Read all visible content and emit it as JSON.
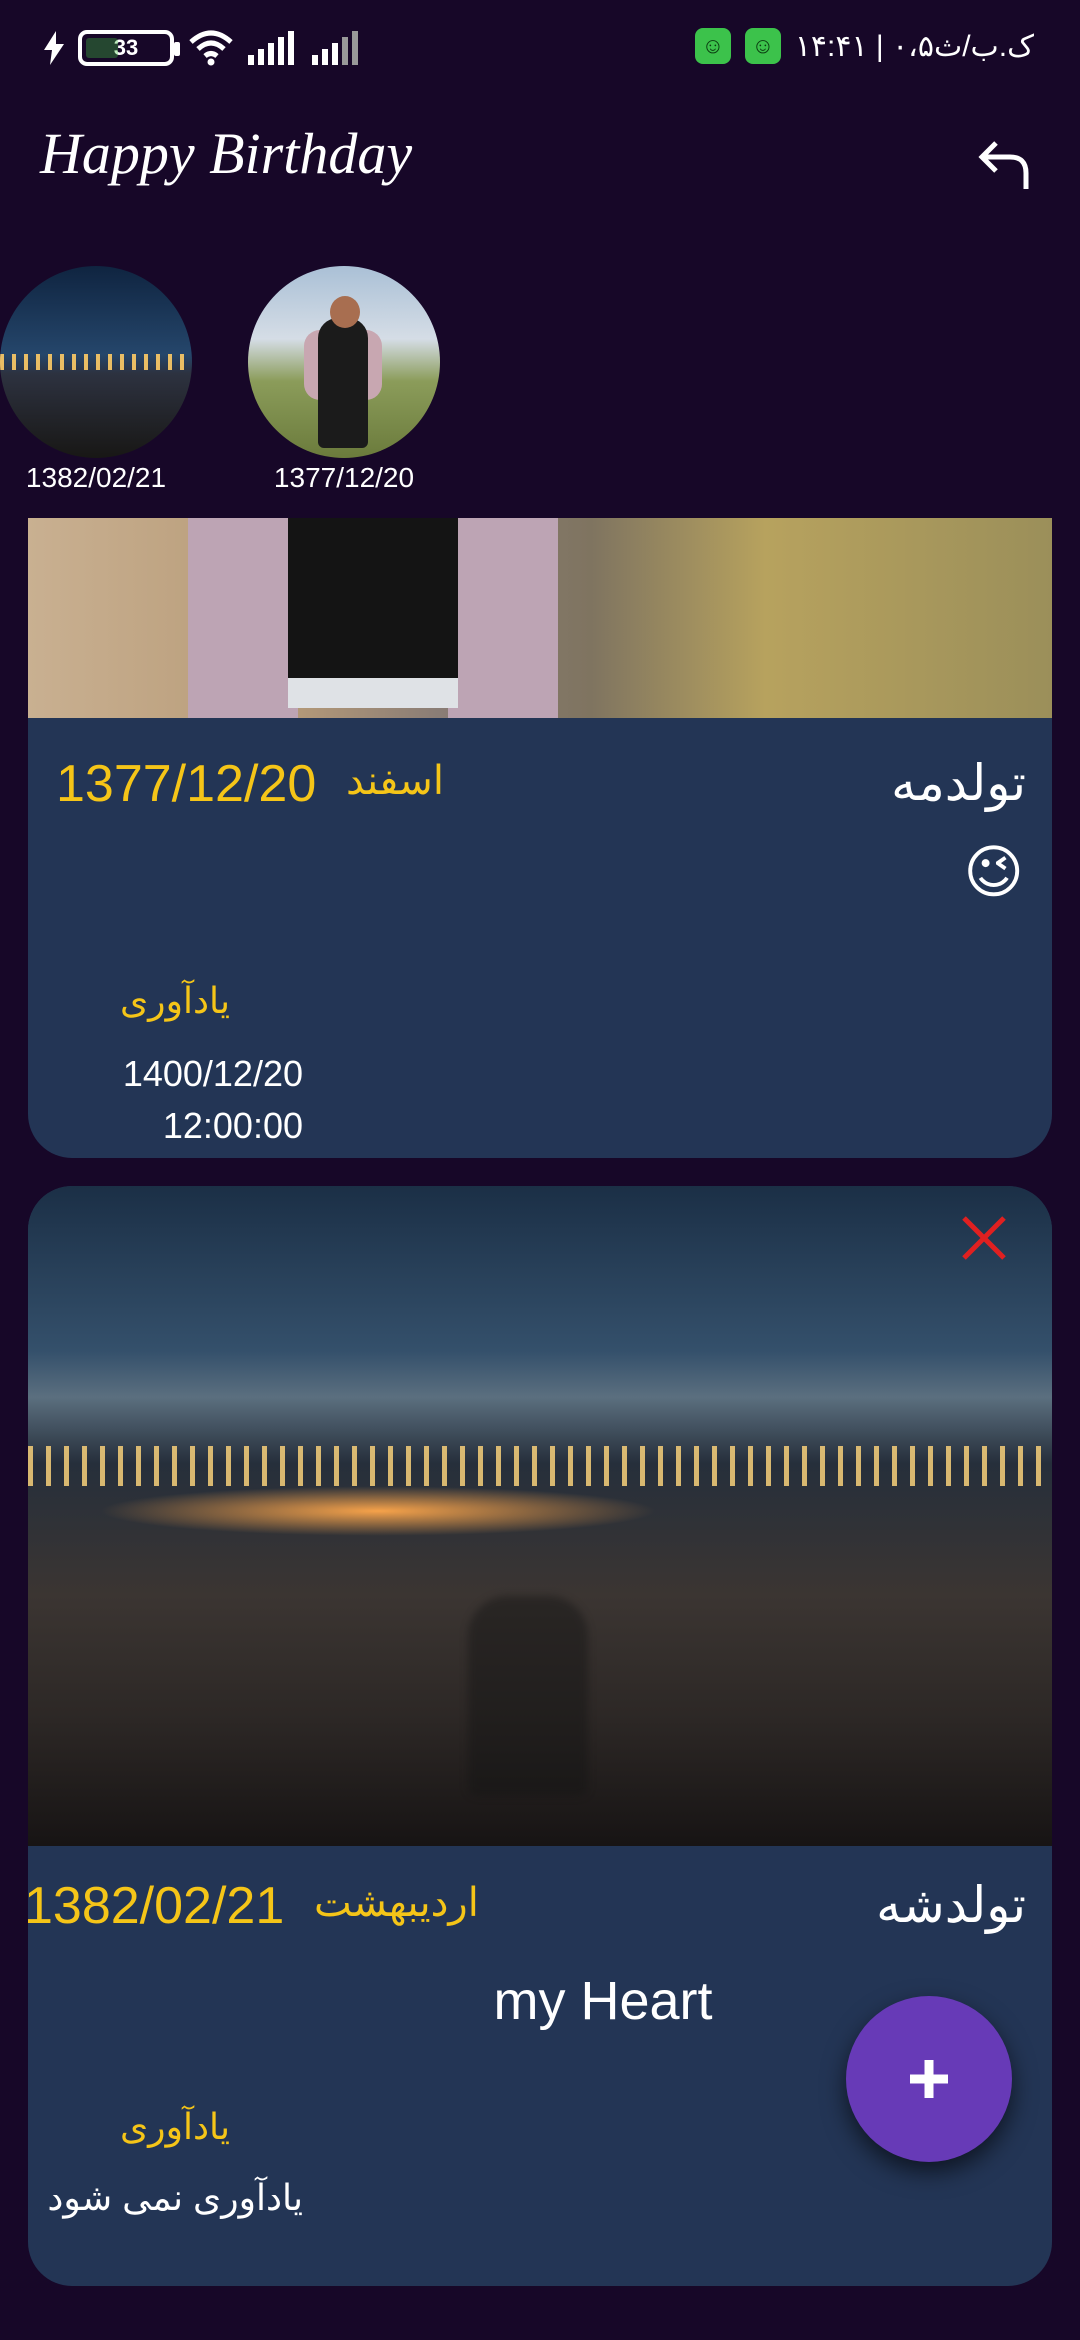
{
  "status_bar": {
    "battery": "33",
    "right_text": "۱۴:۴۱ | ۰،۵ک.ب/ث"
  },
  "app": {
    "title": "Happy Birthday"
  },
  "stories": [
    {
      "date": "1382/02/21"
    },
    {
      "date": "1377/12/20"
    }
  ],
  "cards": [
    {
      "title": "تولدمه",
      "month": "اسفند",
      "date": "1377/12/20",
      "emoji": "😉",
      "reminder_label": "یادآوری",
      "reminder_date": "1400/12/20",
      "reminder_time": "12:00:00"
    },
    {
      "title": "تولدشه",
      "month": "اردیبهشت",
      "date": "1382/02/21",
      "message": "my Heart",
      "reminder_label": "یادآوری",
      "reminder_text": "یادآوری نمی شود"
    }
  ],
  "fab": {
    "label": "+"
  },
  "colors": {
    "background": "#170728",
    "card": "#233555",
    "accent_yellow": "#f5c518",
    "fab": "#673ab7",
    "close_red": "#e02020"
  }
}
